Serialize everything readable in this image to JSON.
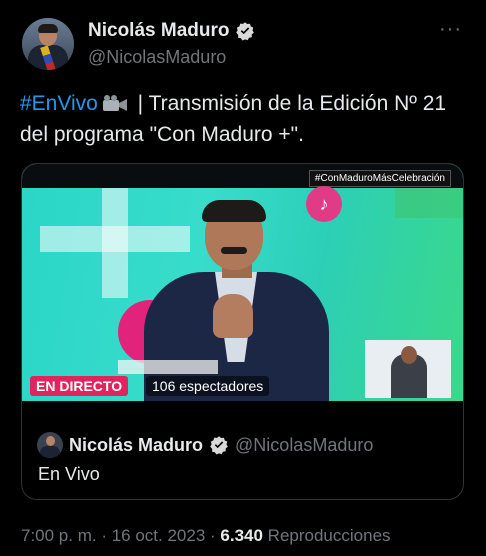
{
  "author": {
    "display_name": "Nicolás Maduro",
    "handle": "@NicolasMaduro"
  },
  "tweet": {
    "hashtag": "#EnVivo",
    "text_after_icon": " | Transmisión de la Edición Nº 21 del programa \"Con Maduro +\"."
  },
  "video": {
    "overlay_hashtag": "#ConMaduroMásCelebración",
    "live_label": "EN DIRECTO",
    "viewers": "106 espectadores",
    "tiktok_glyph": "♪"
  },
  "quoted": {
    "display_name": "Nicolás Maduro",
    "handle": "@NicolasMaduro",
    "text": "En Vivo"
  },
  "meta": {
    "time": "7:00 p. m.",
    "separator": " · ",
    "date": "16 oct. 2023",
    "views_count": "6.340",
    "views_label": " Reproducciones"
  },
  "colors": {
    "accent": "#1d9bf0",
    "live": "#e0245e"
  },
  "icons": [
    "verified-badge-icon",
    "more-icon",
    "movie-camera-icon",
    "tiktok-icon"
  ]
}
